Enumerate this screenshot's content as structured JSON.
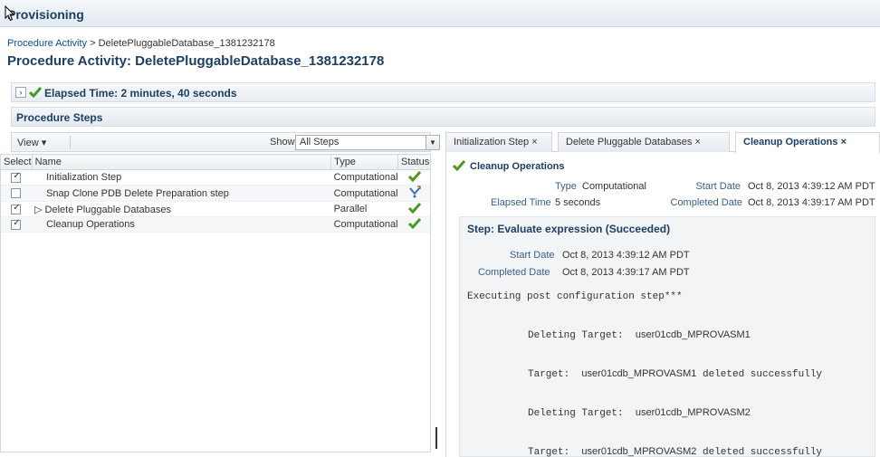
{
  "header": {
    "title": "Provisioning"
  },
  "breadcrumb": {
    "link": "Procedure Activity",
    "separator": ">",
    "current": "DeletePluggableDatabase_1381232178"
  },
  "page_title": "Procedure Activity: DeletePluggableDatabase_1381232178",
  "elapsed": {
    "label": "Elapsed Time: 2 minutes, 40 seconds"
  },
  "steps_section": {
    "title": "Procedure Steps"
  },
  "toolbar": {
    "view_label": "View ▾",
    "show_label": "Show",
    "show_value": "All Steps"
  },
  "table": {
    "columns": [
      "Select",
      "Name",
      "Type",
      "Status"
    ],
    "rows": [
      {
        "checked": true,
        "name": "Initialization Step",
        "type": "Computational",
        "status": "succeeded",
        "expandable": false
      },
      {
        "checked": false,
        "name": "Snap Clone PDB Delete Preparation step",
        "type": "Computational",
        "status": "skipped",
        "expandable": false
      },
      {
        "checked": true,
        "name": "Delete Pluggable Databases",
        "type": "Parallel",
        "status": "succeeded",
        "expandable": true
      },
      {
        "checked": true,
        "name": "Cleanup Operations",
        "type": "Computational",
        "status": "succeeded",
        "expandable": false
      }
    ]
  },
  "tabs": [
    {
      "label": "Initialization Step ×",
      "active": false
    },
    {
      "label": "Delete Pluggable Databases ×",
      "active": false
    },
    {
      "label": "Cleanup Operations ×",
      "active": true
    }
  ],
  "detail": {
    "title": "Cleanup Operations",
    "type_label": "Type",
    "type_value": "Computational",
    "start_label": "Start Date",
    "start_value": "Oct 8, 2013 4:39:12 AM PDT",
    "elapsed_label": "Elapsed Time",
    "elapsed_value": "5 seconds",
    "completed_label": "Completed Date",
    "completed_value": "Oct 8, 2013 4:39:17 AM PDT"
  },
  "step": {
    "title": "Step: Evaluate expression (Succeeded)",
    "start_label": "Start Date",
    "start_value": "Oct 8, 2013 4:39:12 AM PDT",
    "completed_label": "Completed Date",
    "completed_value": "Oct 8, 2013 4:39:17 AM PDT",
    "log_line1": "Executing post configuration step***",
    "log_line2_prefix": "Deleting Target:",
    "log_line2_target": "user01cdb_MPROVASM1",
    "log_line3_prefix": "Target:",
    "log_line3_target": "user01cdb_MPROVASM1",
    "log_line3_suffix": "deleted successfully",
    "log_line4_prefix": "Deleting Target:",
    "log_line4_target": "user01cdb_MPROVASM2",
    "log_line5_prefix": "Target:",
    "log_line5_target": "user01cdb_MPROVASM2",
    "log_line5_suffix": "deleted successfully"
  },
  "colors": {
    "accent": "#1c3f63",
    "success": "#4a9a1e",
    "link": "#0a4f8e"
  },
  "icons": {
    "succeeded": "check-icon",
    "skipped": "skip-icon"
  }
}
